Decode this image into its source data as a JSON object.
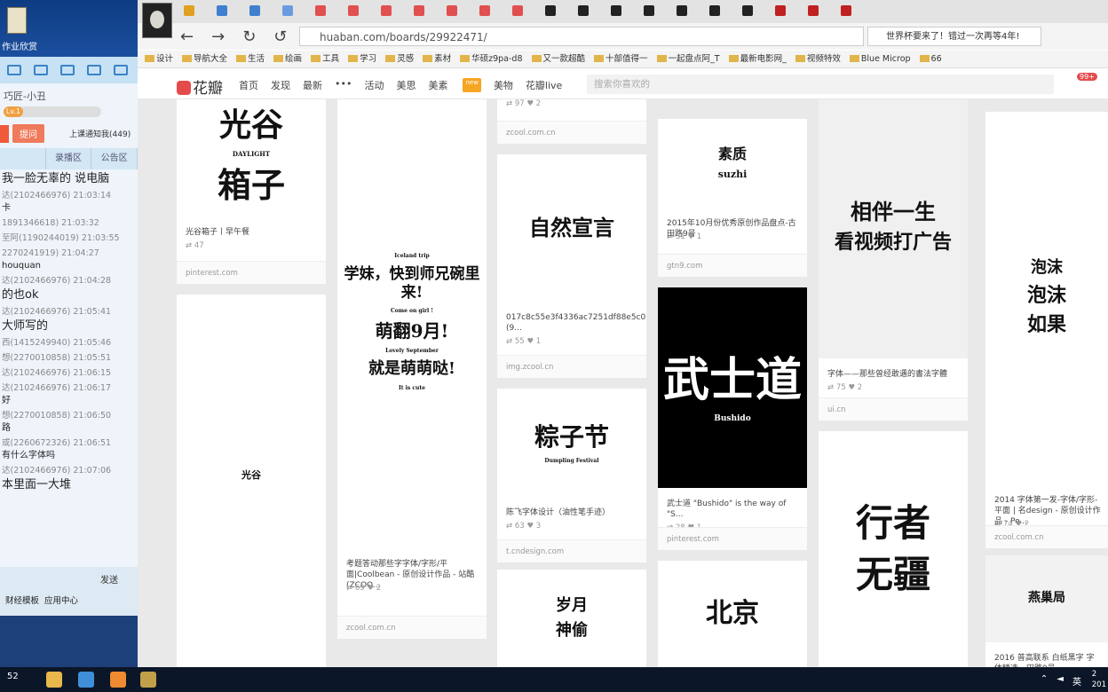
{
  "desktop": {
    "icon_label": "作业欣赏"
  },
  "chat": {
    "user": "巧匠-小丑",
    "level": "Lv.1",
    "ask_button": "提问",
    "subscribe": "上课通知我(449)",
    "tabs": [
      "",
      "录播区",
      "公告区"
    ],
    "messages": [
      {
        "kind": "big",
        "text": "我一脸无辜的   说电脑"
      },
      {
        "kind": "meta",
        "text": "达(2102466976) 21:03:14"
      },
      {
        "kind": "txt",
        "text": "卡"
      },
      {
        "kind": "meta",
        "text": "1891346618) 21:03:32"
      },
      {
        "kind": "meta",
        "text": "至阿(1190244019) 21:03:55"
      },
      {
        "kind": "meta",
        "text": "2270241919) 21:04:27"
      },
      {
        "kind": "txt",
        "text": "houquan"
      },
      {
        "kind": "meta",
        "text": "达(2102466976) 21:04:28"
      },
      {
        "kind": "big",
        "text": "的也ok"
      },
      {
        "kind": "meta",
        "text": "达(2102466976) 21:05:41"
      },
      {
        "kind": "big",
        "text": "大师写的"
      },
      {
        "kind": "meta",
        "text": "西(1415249940) 21:05:46"
      },
      {
        "kind": "meta",
        "text": "想(2270010858) 21:05:51"
      },
      {
        "kind": "meta",
        "text": "达(2102466976) 21:06:15"
      },
      {
        "kind": "meta",
        "text": "达(2102466976) 21:06:17"
      },
      {
        "kind": "txt",
        "text": "好"
      },
      {
        "kind": "meta",
        "text": "想(2270010858) 21:06:50"
      },
      {
        "kind": "txt",
        "text": "路"
      },
      {
        "kind": "meta",
        "text": "或(2260672326) 21:06:51"
      },
      {
        "kind": "txt",
        "text": "有什么字体吗"
      },
      {
        "kind": "meta",
        "text": "达(2102466976) 21:07:06"
      },
      {
        "kind": "big",
        "text": "本里面一大堆"
      }
    ],
    "send": "发送",
    "apps": [
      "财经模板",
      "应用中心"
    ]
  },
  "browser": {
    "url": "huaban.com/boards/29922471/",
    "search_box": "世界杯要来了！错过一次再等4年!",
    "bookmarks": [
      "设计",
      "导航大全",
      "生活",
      "绘画",
      "工具",
      "学习",
      "灵感",
      "素材",
      "华硕z9pa-d8",
      "又一款超酷",
      "十部值得一",
      "一起盘点阿_T",
      "最新电影网_",
      "视频特效",
      "Blue Microp",
      "66"
    ]
  },
  "huaban": {
    "logo": "花瓣",
    "nav": [
      "首页",
      "发现",
      "最新",
      "•••",
      "活动",
      "美思",
      "美素",
      "美物",
      "花瓣live"
    ],
    "new_badge": "new",
    "search_placeholder": "搜索你喜欢的",
    "notif": "99+"
  },
  "pins": [
    {
      "art": [
        "光谷",
        "DAYLIGHT",
        "箱子"
      ],
      "desc": "光谷箱子丨早午餐",
      "repins": "47",
      "likes": "",
      "src": "pinterest.com"
    },
    {
      "art": [
        "光谷",
        "",
        ""
      ],
      "desc": "",
      "repins": "",
      "likes": "",
      "src": ""
    },
    {
      "art": [
        "Iceland trip",
        "学妹，快到师兄碗里来!",
        "Come on girl !",
        "萌翻9月!",
        "Lovely September",
        "就是萌萌哒!",
        "It is cute"
      ],
      "desc": "考题答动那些字字体/字形/平面|Coolbean - 原创设计作品 - 站酷 (ZCOO...",
      "repins": "69",
      "likes": "2",
      "src": "zcool.com.cn"
    },
    {
      "art": [
        "97",
        "2"
      ],
      "desc": "",
      "repins": "97",
      "likes": "2",
      "src": "zcool.com.cn"
    },
    {
      "art": [
        "自然宣言"
      ],
      "desc": "017c8c55e3f4336ac7251df88e5c02.jpg@900w_1l (9...",
      "repins": "55",
      "likes": "1",
      "src": "img.zcool.cn"
    },
    {
      "art": [
        "粽子节",
        "Dumpling Festival"
      ],
      "desc": "陈飞字体设计（油性笔手迹）",
      "repins": "63",
      "likes": "3",
      "src": "t.cndesign.com"
    },
    {
      "art": [
        "岁月",
        "神偷"
      ],
      "desc": "",
      "repins": "",
      "likes": "",
      "src": ""
    },
    {
      "art": [
        "素质",
        "suzhi"
      ],
      "desc": "2015年10月份优秀原创作品盘点-古田路9号",
      "repins": "31",
      "likes": "1",
      "src": "gtn9.com"
    },
    {
      "art": [
        "武士道",
        "Bushido"
      ],
      "desc": "武士道 \"Bushido\" is the way of \"S...",
      "repins": "28",
      "likes": "1",
      "src": "pinterest.com"
    },
    {
      "art": [
        "北京"
      ],
      "desc": "",
      "repins": "",
      "likes": "",
      "src": ""
    },
    {
      "art": [
        "相伴一生",
        "看视频打广告"
      ],
      "desc": "字体——那些曾经敢遇的書法字體",
      "repins": "75",
      "likes": "2",
      "src": "ui.cn"
    },
    {
      "art": [
        "行者",
        "无疆"
      ],
      "desc": "",
      "repins": "",
      "likes": "",
      "src": ""
    },
    {
      "art": [
        "泡沫",
        "泡沫",
        "如果"
      ],
      "desc": "2014 字体第一发-字体/字形-平面 | 名design - 原创设计作品 - Po...",
      "repins": "74",
      "likes": "2",
      "src": "zcool.com.cn"
    },
    {
      "art": [
        "燕巢局"
      ],
      "desc": "2016 普高联系 白纸黑字 字体精选 - 田路9号",
      "repins": "",
      "likes": "",
      "src": ""
    }
  ],
  "taskbar": {
    "num": "52",
    "ime": "英",
    "time": "2",
    "date": "201"
  }
}
